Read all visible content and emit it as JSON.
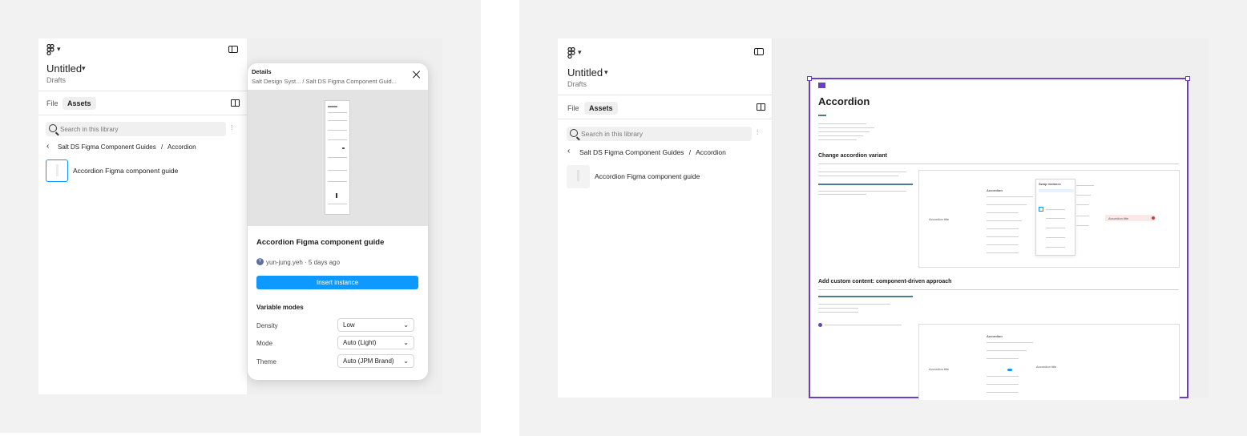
{
  "left": {
    "file_title": "Untitled",
    "location": "Drafts",
    "tabs": [
      {
        "label": "File"
      },
      {
        "label": "Assets"
      }
    ],
    "search_placeholder": "Search in this library",
    "breadcrumb": {
      "library": "Salt DS Figma Component Guides",
      "separator": "/",
      "page": "Accordion"
    },
    "item_label": "Accordion Figma component guide",
    "details": {
      "heading": "Details",
      "path_a": "Salt Design Syst...",
      "path_b": "/ Salt DS Figma Component Guid...",
      "component_title": "Accordion Figma component guide",
      "avatar_letter": "Y",
      "author": "yun-jung.yeh",
      "age": "· 5 days ago",
      "insert_label": "Insert instance",
      "variable_modes_heading": "Variable modes",
      "modes": [
        {
          "label": "Density",
          "value": "Low"
        },
        {
          "label": "Mode",
          "value": "Auto (Light)"
        },
        {
          "label": "Theme",
          "value": "Auto (JPM Brand)"
        }
      ]
    }
  },
  "right": {
    "file_title": "Untitled",
    "location": "Drafts",
    "tabs": [
      {
        "label": "File"
      },
      {
        "label": "Assets"
      }
    ],
    "search_placeholder": "Search in this library",
    "breadcrumb": {
      "library": "Salt DS Figma Component Guides",
      "separator": "/",
      "page": "Accordion"
    },
    "item_label": "Accordion Figma component guide",
    "doc": {
      "title": "Accordion",
      "section1": "Change accordion variant",
      "section2": "Add custom content: component-driven approach",
      "frame_a_title": "Accordion title",
      "frame_b_title": "Accordion title",
      "frame_c_title": "Accordion title",
      "frame_d_title": "Accordion title",
      "panel_heading": "Accordion",
      "swap_label": "Swap instance"
    }
  },
  "colors": {
    "accent": "#0d99ff",
    "canvas_selection": "#6b3fbf",
    "scene_bg": "#f2f2f2"
  }
}
